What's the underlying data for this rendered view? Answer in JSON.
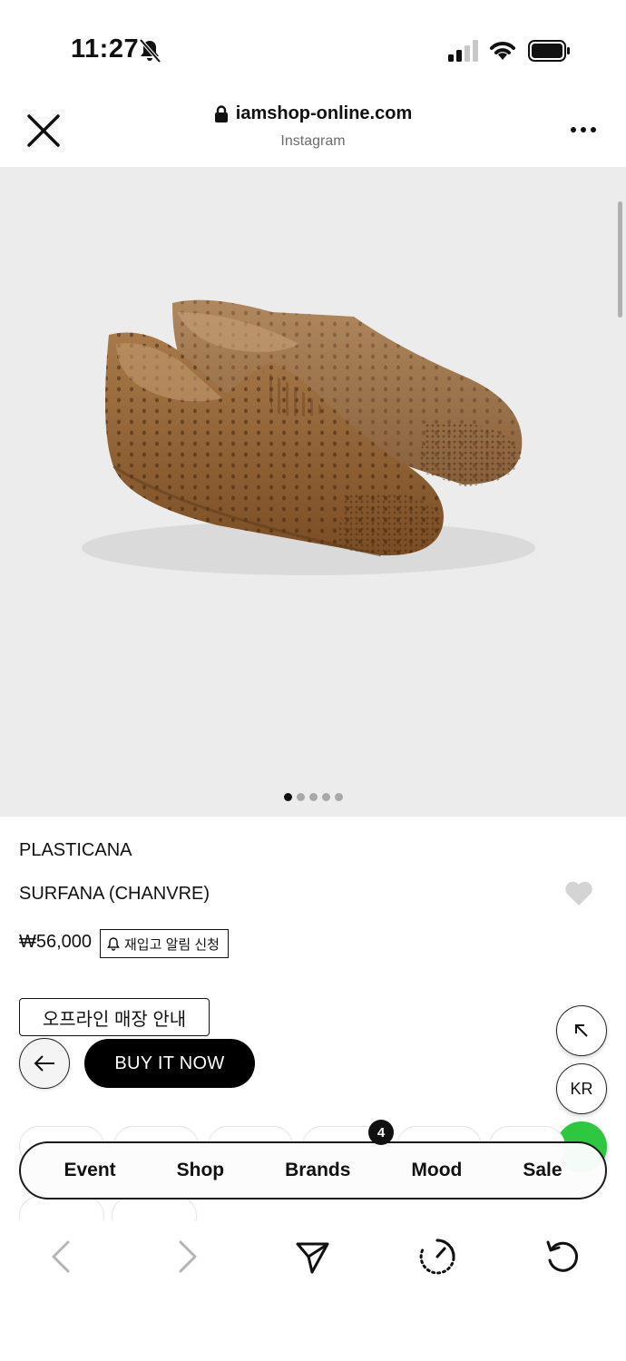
{
  "status_bar": {
    "time": "11:27",
    "icons": [
      "bell-slash-icon",
      "cellular-signal-icon",
      "wifi-icon",
      "battery-icon"
    ]
  },
  "browser": {
    "url": "iamshop-online.com",
    "source": "Instagram",
    "icons": [
      "close-icon",
      "lock-icon",
      "more-icon"
    ]
  },
  "gallery": {
    "image": "brown perforated rubber water shoes",
    "dot_count": 5,
    "active_index": 0
  },
  "product": {
    "brand": "PLASTICANA",
    "name": "SURFANA (CHANVRE)",
    "price": "₩56,000",
    "restock_label": "재입고 알림 신청",
    "store_info_label": "오프라인 매장 안내",
    "buy_label": "BUY IT NOW"
  },
  "floating": {
    "lang_label": "KR",
    "badge_count": "4"
  },
  "nav": {
    "items": [
      {
        "label": "Event"
      },
      {
        "label": "Shop"
      },
      {
        "label": "Brands"
      },
      {
        "label": "Mood"
      },
      {
        "label": "Sale"
      }
    ]
  },
  "toolbar": {
    "icons": [
      "back-arrow-icon",
      "forward-arrow-icon",
      "share-icon",
      "speed-icon",
      "reload-icon"
    ]
  },
  "colors": {
    "hero_bg": "#ececec",
    "buy_bg": "#000000",
    "green_fab": "#2ec840",
    "shoe": "#8a5a30"
  }
}
